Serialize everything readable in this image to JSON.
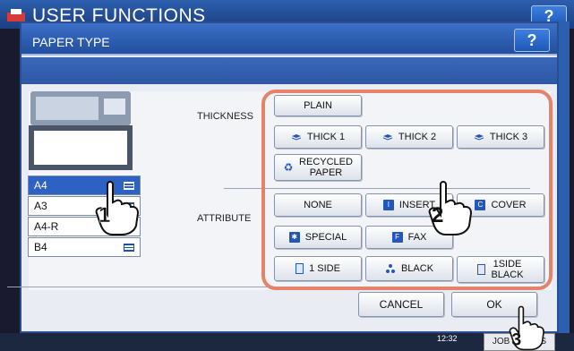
{
  "outer": {
    "title": "USER FUNCTIONS",
    "help_label": "?"
  },
  "dialog": {
    "title": "PAPER TYPE",
    "help_label": "?"
  },
  "paper_sizes": [
    {
      "label": "A4",
      "selected": true
    },
    {
      "label": "A3",
      "selected": false
    },
    {
      "label": "A4-R",
      "selected": false
    },
    {
      "label": "B4",
      "selected": false
    }
  ],
  "labels": {
    "thickness": "THICKNESS",
    "attribute": "ATTRIBUTE"
  },
  "thickness_buttons": {
    "plain": "PLAIN",
    "thick1": "THICK 1",
    "thick2": "THICK 2",
    "thick3": "THICK 3",
    "recycled_line1": "RECYCLED",
    "recycled_line2": "PAPER"
  },
  "attribute_buttons": {
    "none": "NONE",
    "insert": "INSERT",
    "cover": "COVER",
    "special": "SPECIAL",
    "fax": "FAX",
    "one_side": "1 SIDE",
    "black": "BLACK",
    "one_side_black_line1": "1SIDE",
    "one_side_black_line2": "BLACK"
  },
  "actions": {
    "cancel": "CANCEL",
    "ok": "OK"
  },
  "status": {
    "time": "12:32",
    "job_status": "JOB STATUS"
  },
  "callouts": [
    "1",
    "2",
    "3"
  ],
  "colors": {
    "highlight": "#e4836a",
    "selected": "#2d62c4",
    "header": "#2c5fae"
  }
}
